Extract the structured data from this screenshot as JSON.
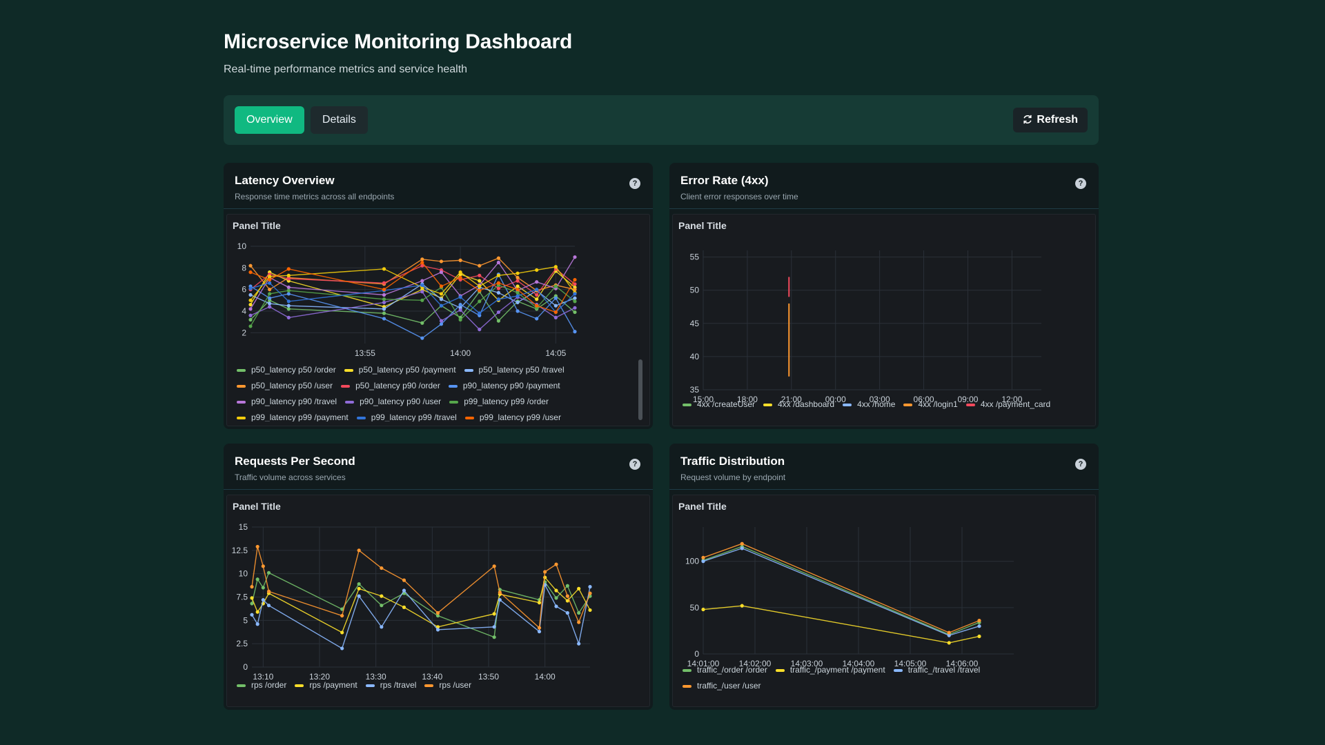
{
  "header": {
    "title": "Microservice Monitoring Dashboard",
    "subtitle": "Real-time performance metrics and service health"
  },
  "toolbar": {
    "tabs": [
      {
        "label": "Overview",
        "active": true
      },
      {
        "label": "Details",
        "active": false
      }
    ],
    "refresh_label": "Refresh",
    "refresh_icon": "refresh-icon"
  },
  "colors": {
    "accent": "#10b981",
    "background": "#0f2a27",
    "card": "#111b1d",
    "panel": "#181b1f",
    "grid": "#2a3038",
    "axis_text": "#c9d1d9"
  },
  "cards": [
    {
      "title": "Latency Overview",
      "subtitle": "Response time metrics across all endpoints",
      "panel_title": "Panel Title"
    },
    {
      "title": "Error Rate (4xx)",
      "subtitle": "Client error responses over time",
      "panel_title": "Panel Title"
    },
    {
      "title": "Requests Per Second",
      "subtitle": "Traffic volume across services",
      "panel_title": "Panel Title"
    },
    {
      "title": "Traffic Distribution",
      "subtitle": "Request volume by endpoint",
      "panel_title": "Panel Title"
    }
  ],
  "chart_data": [
    {
      "type": "line",
      "title": "Panel Title",
      "x_ticks": [
        "13:55",
        "14:00",
        "14:05"
      ],
      "y_ticks": [
        "2",
        "4",
        "6",
        "8",
        "10"
      ],
      "ylim": [
        1,
        10
      ],
      "x_domain": [
        "13:49",
        "14:06"
      ],
      "legend_position": "bottom",
      "series": [
        {
          "name": "p50_latency p50 /order",
          "color": "#73bf69",
          "x": [
            "13:49",
            "13:50",
            "13:51",
            "13:56",
            "13:58",
            "13:59",
            "14:00",
            "14:01",
            "14:02",
            "14:03",
            "14:04",
            "14:05",
            "14:06"
          ],
          "values": [
            3.2,
            5.0,
            4.2,
            3.8,
            2.9,
            4.5,
            3.4,
            5.8,
            3.1,
            4.9,
            4.2,
            5.4,
            3.9
          ]
        },
        {
          "name": "p50_latency p50 /payment",
          "color": "#fade2a",
          "x": [
            "13:49",
            "13:50",
            "13:51",
            "13:56",
            "13:58",
            "13:59",
            "14:00",
            "14:01",
            "14:02",
            "14:03",
            "14:04",
            "14:05",
            "14:06"
          ],
          "values": [
            4.6,
            7.6,
            6.8,
            4.4,
            6.0,
            5.2,
            7.4,
            6.8,
            5.0,
            6.3,
            5.1,
            7.7,
            6.2
          ]
        },
        {
          "name": "p50_latency p50 /travel",
          "color": "#8ab8ff",
          "x": [
            "13:49",
            "13:50",
            "13:51",
            "13:56",
            "13:58",
            "13:59",
            "14:00",
            "14:01",
            "14:02",
            "14:03",
            "14:04",
            "14:05",
            "14:06"
          ],
          "values": [
            5.5,
            4.7,
            4.5,
            4.2,
            6.5,
            5.1,
            4.3,
            6.2,
            5.7,
            4.8,
            5.9,
            4.5,
            5.2
          ]
        },
        {
          "name": "p50_latency p50 /user",
          "color": "#ff9830",
          "x": [
            "13:49",
            "13:50",
            "13:51",
            "13:56",
            "13:58",
            "13:59",
            "14:00",
            "14:01",
            "14:02",
            "14:03",
            "14:04",
            "14:05",
            "14:06"
          ],
          "values": [
            8.2,
            6.0,
            7.1,
            6.5,
            8.8,
            8.6,
            8.7,
            8.2,
            8.9,
            7.1,
            5.9,
            6.4,
            6.0
          ]
        },
        {
          "name": "p50_latency p90 /order",
          "color": "#f2495c",
          "x": [
            "13:49",
            "13:50",
            "13:51",
            "13:56",
            "13:58",
            "13:59",
            "14:00",
            "14:01",
            "14:02",
            "14:03",
            "14:04",
            "14:05",
            "14:06"
          ],
          "values": [
            6.0,
            7.4,
            7.0,
            6.6,
            8.2,
            7.8,
            6.9,
            7.3,
            6.1,
            6.8,
            5.5,
            7.9,
            6.5
          ]
        },
        {
          "name": "p90_latency p90 /payment",
          "color": "#5794f2",
          "x": [
            "13:49",
            "13:50",
            "13:51",
            "13:56",
            "13:58",
            "13:59",
            "14:00",
            "14:01",
            "14:02",
            "14:03",
            "14:04",
            "14:05",
            "14:06"
          ],
          "values": [
            6.3,
            5.2,
            5.6,
            3.3,
            1.5,
            2.8,
            4.6,
            3.6,
            7.4,
            4.0,
            3.3,
            5.2,
            2.1
          ]
        },
        {
          "name": "p90_latency p90 /travel",
          "color": "#b877d9",
          "x": [
            "13:49",
            "13:50",
            "13:51",
            "13:56",
            "13:58",
            "13:59",
            "14:00",
            "14:01",
            "14:02",
            "14:03",
            "14:04",
            "14:05",
            "14:06"
          ],
          "values": [
            4.2,
            7.1,
            6.2,
            5.5,
            6.8,
            7.6,
            5.4,
            6.4,
            8.5,
            5.9,
            6.7,
            6.1,
            9.0
          ]
        },
        {
          "name": "p90_latency p90 /user",
          "color": "#8f6bd8",
          "x": [
            "13:49",
            "13:50",
            "13:51",
            "13:56",
            "13:58",
            "13:59",
            "14:00",
            "14:01",
            "14:02",
            "14:03",
            "14:04",
            "14:05",
            "14:06"
          ],
          "values": [
            3.6,
            4.4,
            3.4,
            4.8,
            5.8,
            3.1,
            4.1,
            2.3,
            3.9,
            5.3,
            4.6,
            3.4,
            4.3
          ]
        },
        {
          "name": "p99_latency p99 /order",
          "color": "#56a64b",
          "x": [
            "13:49",
            "13:50",
            "13:51",
            "13:56",
            "13:58",
            "13:59",
            "14:00",
            "14:01",
            "14:02",
            "14:03",
            "14:04",
            "14:05",
            "14:06"
          ],
          "values": [
            2.6,
            5.6,
            5.9,
            5.1,
            5.0,
            6.2,
            3.2,
            4.9,
            6.4,
            5.7,
            4.3,
            6.3,
            4.9
          ]
        },
        {
          "name": "p99_latency p99 /payment",
          "color": "#f2cc0c",
          "x": [
            "13:49",
            "13:50",
            "13:51",
            "13:56",
            "13:58",
            "13:59",
            "14:00",
            "14:01",
            "14:02",
            "14:03",
            "14:04",
            "14:05",
            "14:06"
          ],
          "values": [
            5.0,
            7.2,
            7.3,
            7.9,
            6.2,
            5.6,
            7.6,
            6.3,
            7.3,
            7.5,
            7.8,
            8.1,
            5.7
          ]
        },
        {
          "name": "p99_latency p99 /travel",
          "color": "#3274d9",
          "x": [
            "13:49",
            "13:50",
            "13:51",
            "13:56",
            "13:58",
            "13:59",
            "14:00",
            "14:01",
            "14:02",
            "14:03",
            "14:04",
            "14:05",
            "14:06"
          ],
          "values": [
            6.1,
            6.6,
            4.9,
            5.9,
            6.4,
            4.5,
            5.3,
            3.8,
            5.1,
            5.4,
            6.0,
            3.9,
            5.6
          ]
        },
        {
          "name": "p99_latency p99 /user",
          "color": "#fa6400",
          "x": [
            "13:49",
            "13:50",
            "13:51",
            "13:56",
            "13:58",
            "13:59",
            "14:00",
            "14:01",
            "14:02",
            "14:03",
            "14:04",
            "14:05",
            "14:06"
          ],
          "values": [
            7.6,
            6.9,
            7.9,
            6.0,
            8.5,
            6.3,
            7.1,
            5.9,
            6.6,
            6.0,
            4.5,
            3.9,
            6.9
          ]
        }
      ]
    },
    {
      "type": "line",
      "title": "Panel Title",
      "x_ticks": [
        "15:00",
        "18:00",
        "21:00",
        "00:00",
        "03:00",
        "06:00",
        "09:00",
        "12:00"
      ],
      "y_ticks": [
        "35",
        "40",
        "45",
        "50",
        "55"
      ],
      "ylim": [
        35,
        56
      ],
      "x_domain": [
        "15:00",
        "14:00 next day"
      ],
      "legend_position": "bottom",
      "series": [
        {
          "name": "4xx /createUser",
          "color": "#73bf69",
          "x": [],
          "values": []
        },
        {
          "name": "4xx /dashboard",
          "color": "#fade2a",
          "x": [],
          "values": []
        },
        {
          "name": "4xx /home",
          "color": "#8ab8ff",
          "x": [],
          "values": []
        },
        {
          "name": "4xx /login1",
          "color": "#ff9830",
          "x": [
            "20:50",
            "20:50"
          ],
          "values": [
            37,
            48
          ]
        },
        {
          "name": "4xx /payment_card",
          "color": "#f2495c",
          "x": [
            "20:50",
            "20:50"
          ],
          "values": [
            49,
            52
          ]
        }
      ]
    },
    {
      "type": "line",
      "title": "Panel Title",
      "x_ticks": [
        "13:10",
        "13:20",
        "13:30",
        "13:40",
        "13:50",
        "14:00"
      ],
      "y_ticks": [
        "0",
        "2.5",
        "5",
        "7.5",
        "10",
        "12.5",
        "15"
      ],
      "ylim": [
        0,
        15
      ],
      "x_domain": [
        "13:08",
        "14:08"
      ],
      "legend_position": "bottom",
      "series": [
        {
          "name": "rps /order",
          "color": "#73bf69",
          "x": [
            "13:08",
            "13:09",
            "13:10",
            "13:11",
            "13:24",
            "13:27",
            "13:31",
            "13:35",
            "13:41",
            "13:51",
            "13:52",
            "13:59",
            "14:00",
            "14:02",
            "14:04",
            "14:06",
            "14:08"
          ],
          "values": [
            6.8,
            9.4,
            8.5,
            10.1,
            6.2,
            8.9,
            6.6,
            7.9,
            5.5,
            3.2,
            8.3,
            7.2,
            9.1,
            7.4,
            8.7,
            5.8,
            7.6
          ]
        },
        {
          "name": "rps /payment",
          "color": "#fade2a",
          "x": [
            "13:08",
            "13:09",
            "13:10",
            "13:11",
            "13:24",
            "13:27",
            "13:31",
            "13:35",
            "13:41",
            "13:51",
            "13:52",
            "13:59",
            "14:00",
            "14:02",
            "14:04",
            "14:06",
            "14:08"
          ],
          "values": [
            7.4,
            5.9,
            6.8,
            7.9,
            3.7,
            8.4,
            7.6,
            6.4,
            4.3,
            5.7,
            7.8,
            6.9,
            9.6,
            8.2,
            7.1,
            8.4,
            6.1
          ]
        },
        {
          "name": "rps /travel",
          "color": "#8ab8ff",
          "x": [
            "13:08",
            "13:09",
            "13:10",
            "13:11",
            "13:24",
            "13:27",
            "13:31",
            "13:35",
            "13:41",
            "13:51",
            "13:52",
            "13:59",
            "14:00",
            "14:02",
            "14:04",
            "14:06",
            "14:08"
          ],
          "values": [
            5.6,
            4.6,
            7.2,
            6.6,
            2.0,
            7.6,
            4.3,
            8.2,
            4.0,
            4.3,
            7.2,
            3.8,
            8.8,
            6.5,
            5.8,
            2.5,
            8.6
          ]
        },
        {
          "name": "rps /user",
          "color": "#ff9830",
          "x": [
            "13:08",
            "13:09",
            "13:10",
            "13:11",
            "13:24",
            "13:27",
            "13:31",
            "13:35",
            "13:41",
            "13:51",
            "13:52",
            "13:59",
            "14:00",
            "14:02",
            "14:04",
            "14:06",
            "14:08"
          ],
          "values": [
            8.6,
            12.9,
            10.8,
            8.1,
            5.5,
            12.5,
            10.6,
            9.3,
            5.8,
            10.8,
            8.0,
            4.2,
            10.2,
            11.0,
            7.6,
            4.8,
            7.9
          ]
        }
      ]
    },
    {
      "type": "line",
      "title": "Panel Title",
      "x_ticks": [
        "14:01:00",
        "14:02:00",
        "14:03:00",
        "14:04:00",
        "14:05:00",
        "14:06:00"
      ],
      "y_ticks": [
        "0",
        "50",
        "100"
      ],
      "ylim": [
        0,
        137
      ],
      "x_domain": [
        "14:01:00",
        "14:07:00"
      ],
      "legend_position": "bottom",
      "series": [
        {
          "name": "traffic_/order /order",
          "color": "#73bf69",
          "x": [
            "14:01:00",
            "14:01:45",
            "14:05:45",
            "14:06:20"
          ],
          "values": [
            101,
            116,
            21,
            34
          ]
        },
        {
          "name": "traffic_/payment /payment",
          "color": "#fade2a",
          "x": [
            "14:01:00",
            "14:01:45",
            "14:05:45",
            "14:06:20"
          ],
          "values": [
            48,
            52,
            12,
            19
          ]
        },
        {
          "name": "traffic_/travel /travel",
          "color": "#8ab8ff",
          "x": [
            "14:01:00",
            "14:01:45",
            "14:05:45",
            "14:06:20"
          ],
          "values": [
            100,
            114,
            20,
            30
          ]
        },
        {
          "name": "traffic_/user /user",
          "color": "#ff9830",
          "x": [
            "14:01:00",
            "14:01:45",
            "14:05:45",
            "14:06:20"
          ],
          "values": [
            104,
            119,
            23,
            36
          ]
        }
      ]
    }
  ]
}
